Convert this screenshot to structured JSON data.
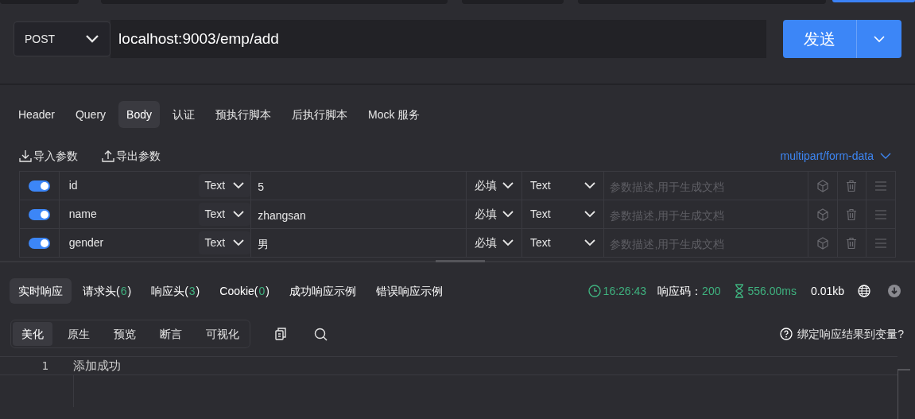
{
  "request": {
    "method": "POST",
    "url": "localhost:9003/emp/add",
    "send_label": "发送"
  },
  "request_tabs": [
    {
      "label": "Header",
      "selected": false
    },
    {
      "label": "Query",
      "selected": false
    },
    {
      "label": "Body",
      "selected": true
    },
    {
      "label": "认证",
      "selected": false
    },
    {
      "label": "预执行脚本",
      "selected": false
    },
    {
      "label": "后执行脚本",
      "selected": false
    },
    {
      "label": "Mock 服务",
      "selected": false
    }
  ],
  "body_toolbar": {
    "import_label": "导入参数",
    "export_label": "导出参数",
    "content_type": "multipart/form-data"
  },
  "params": [
    {
      "enabled": true,
      "key": "id",
      "field_type": "Text",
      "value": "5",
      "required": "必填",
      "value_type": "Text",
      "description_placeholder": "参数描述,用于生成文档"
    },
    {
      "enabled": true,
      "key": "name",
      "field_type": "Text",
      "value": "zhangsan",
      "required": "必填",
      "value_type": "Text",
      "description_placeholder": "参数描述,用于生成文档"
    },
    {
      "enabled": true,
      "key": "gender",
      "field_type": "Text",
      "value": "男",
      "required": "必填",
      "value_type": "Text",
      "description_placeholder": "参数描述,用于生成文档"
    }
  ],
  "response_tabs": [
    {
      "label": "实时响应",
      "selected": true
    },
    {
      "label": "请求头(",
      "count": "6",
      "suffix": ")",
      "selected": false
    },
    {
      "label": "响应头(",
      "count": "3",
      "suffix": ")",
      "selected": false
    },
    {
      "label": "Cookie(",
      "count": "0",
      "suffix": ")",
      "selected": false
    },
    {
      "label": "成功响应示例",
      "selected": false
    },
    {
      "label": "错误响应示例",
      "selected": false
    }
  ],
  "response_stats": {
    "time": "16:26:43",
    "status_label": "响应码：",
    "status_code": "200",
    "duration": "556.00ms",
    "size": "0.01kb"
  },
  "view_modes": [
    {
      "label": "美化",
      "selected": true
    },
    {
      "label": "原生",
      "selected": false
    },
    {
      "label": "预览",
      "selected": false
    },
    {
      "label": "断言",
      "selected": false
    },
    {
      "label": "可视化",
      "selected": false
    }
  ],
  "bind_label": "绑定响应结果到变量?",
  "response_body": [
    {
      "line": "1",
      "text": "添加成功"
    }
  ]
}
